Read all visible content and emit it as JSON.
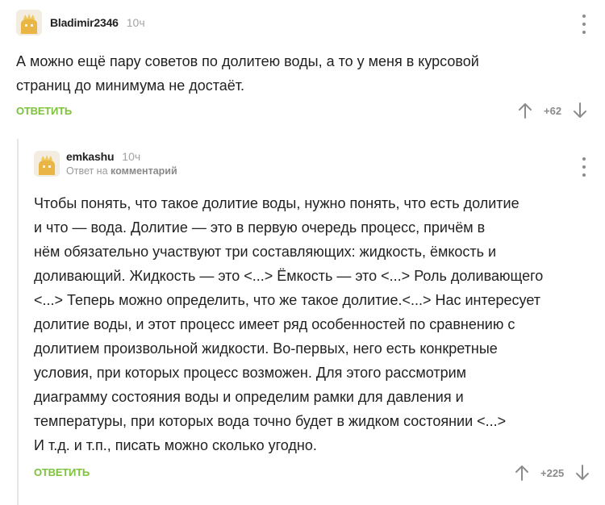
{
  "comment1": {
    "username": "Bladimir2346",
    "time": "10ч",
    "lines": [
      "А можно ещё пару советов по долитею воды, а то у меня в курсовой",
      "страниц до минимума не достаёт."
    ],
    "reply_label": "ОТВЕТИТЬ",
    "rating": "+62"
  },
  "comment2": {
    "username": "emkashu",
    "time": "10ч",
    "reply_prefix": "Ответ на",
    "reply_target": "комментарий",
    "lines": [
      "Чтобы понять, что такое долитие воды, нужно понять, что есть долитие",
      "и что — вода. Долитие — это в первую очередь процесс, причём в",
      "нём обязательно участвуют три составляющих: жидкость, ёмкость и",
      "доливающий. Жидкость — это <...> Ёмкость — это <...> Роль доливающего",
      "<...> Теперь можно определить, что же такое долитие.<...> Нас интересует",
      "долитие воды, и этот процесс имеет ряд особенностей по сравнению с",
      "долитием произвольной жидкости. Во-первых, него есть конкретные",
      "условия, при которых процесс возможен. Для этого рассмотрим",
      "диаграмму состояния воды и определим рамки для давления и",
      "температуры, при которых вода точно будет в жидком состоянии <...>",
      "И т.д. и т.п., писать можно сколько угодно."
    ],
    "reply_label": "ОТВЕТИТЬ",
    "rating": "+225"
  },
  "icons": {
    "avatar": "default-avatar-icon",
    "menu": "more-vertical-icon",
    "upvote": "arrow-up-icon",
    "downvote": "arrow-down-icon"
  },
  "colors": {
    "accent": "#7cc23a",
    "text": "#222222",
    "muted": "#a3a3a3"
  }
}
